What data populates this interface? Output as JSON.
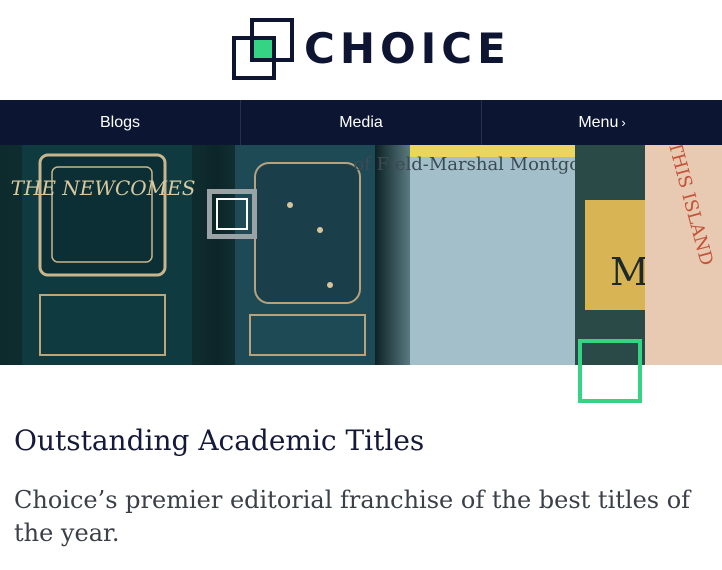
{
  "brand": {
    "name": "CHOICE",
    "logo_icon": "choice-logo-icon",
    "colors": {
      "navy": "#0c1633",
      "accent_green": "#35d484",
      "logo_dark": "#0d1533"
    }
  },
  "nav": {
    "items": [
      {
        "label": "Blogs"
      },
      {
        "label": "Media"
      },
      {
        "label": "Menu",
        "icon": "chevron-right-icon",
        "glyph": "›"
      }
    ]
  },
  "hero": {
    "image": "bookshelf-hero-image",
    "book_spines": [
      "THE NEWCOMES",
      "of Field-Marshal Montgomery",
      "THIS ISLAND",
      "Mc"
    ]
  },
  "content": {
    "title": "Outstanding Academic Titles",
    "subtitle": "Choice’s premier editorial franchise of the best titles of the year."
  }
}
